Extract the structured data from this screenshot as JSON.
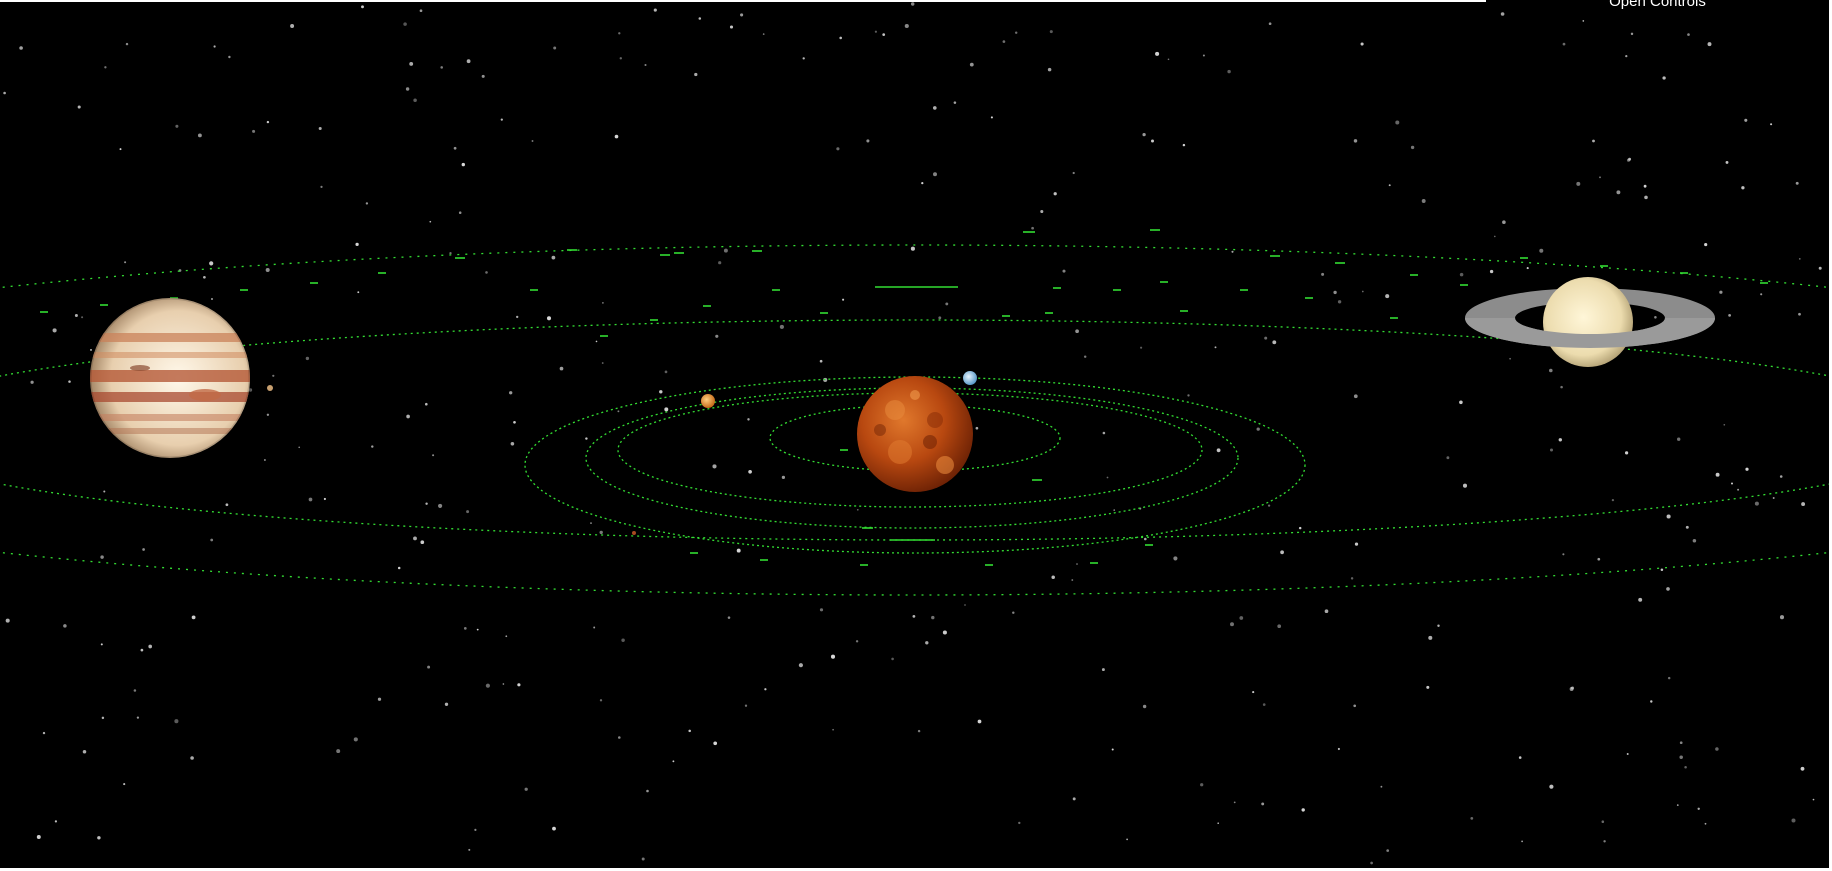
{
  "controls": {
    "toggle_label": "Open Controls"
  },
  "scene": {
    "background_color": "#000000",
    "orbit_color": "#33dd33",
    "star_color": "#d8d8d8",
    "bodies": [
      {
        "name": "sun",
        "icon": "sun-icon"
      },
      {
        "name": "mercury",
        "icon": "mercury-icon"
      },
      {
        "name": "venus",
        "icon": "venus-icon"
      },
      {
        "name": "earth",
        "icon": "earth-icon"
      },
      {
        "name": "mars",
        "icon": "mars-icon"
      },
      {
        "name": "jupiter",
        "icon": "jupiter-icon"
      },
      {
        "name": "saturn",
        "icon": "saturn-icon"
      }
    ]
  }
}
